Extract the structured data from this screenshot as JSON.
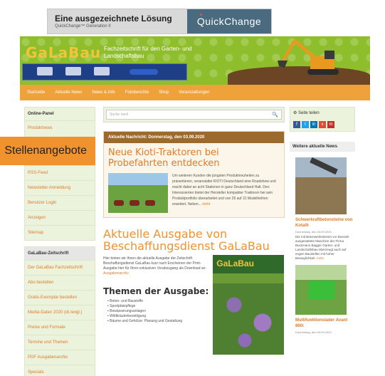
{
  "ad": {
    "title": "Eine ausgezeichnete Lösung",
    "subtitle": "QuickChange™ Generation II",
    "brand": "QuickChange"
  },
  "header": {
    "logo": "GaLaBau",
    "tagline": "Fachzeitschrift für den Garten- und Landschaftsbau"
  },
  "nav": [
    "Startseite",
    "Aktuelle News",
    "News & Info",
    "Fotoberichte",
    "Shop",
    "Veranstaltungen"
  ],
  "overlay_label": "Stellenangebote",
  "left_sidebar": {
    "panel1_title": "Online-Panel",
    "panel1_items": [
      "Produktnews",
      "RSS-Feed",
      "Newsletter Anmeldung",
      "Benutzer Login",
      "Anzeigen",
      "Sitemap"
    ],
    "panel2_title": "GaLaBau-Zeitschrift",
    "panel2_items": [
      "Der GaLaBau Fachzeitschrift",
      "Abo bestellen",
      "Gratis-Exemplar bestellen",
      "Media-Daten 2020 (dt./engl.)",
      "Preise und Formate",
      "Termine und Themen",
      "PDF Ausgabenarchiv",
      "Specials"
    ]
  },
  "main": {
    "search_placeholder": "Suche nach",
    "news_header": "Aktuelle Nachricht: Donnerstag, den 03.09.2020",
    "news_title": "Neue Kioti-Traktoren bei Probefahrten entdecken",
    "news_text": "Um weiteren Kunden die jüngsten Produktneuheiten zu präsentieren, veranstaltet KIOTI Deutschland eine Roadshow und macht dabei an acht Stationen in ganz Deutschland Halt. Den Interessierten bietet der Hersteller kompakter Traktoren bei sein Produktportfolio überarbeitet und von 26 auf 31 Modellreihen erweitert. Neben...",
    "more": "mehr",
    "issue_title": "Aktuelle Ausgabe von Beschaffungsdienst GaLaBau",
    "issue_text": "Hier bieten wir Ihnen die aktuelle Ausgabe der Zeitschrift Beschaffungsdienst GaLaBau kurz nach Erscheinen der Print-Ausgabe hier für Ihren exklusiven Vorabzugang als Download an:",
    "issue_link": "Ausgabenarchiv",
    "cover_title": "GaLaBau",
    "themes_title": "Themen der Ausgabe:",
    "themes": [
      "Beton- und Baustoffe",
      "Sportplatzpflege",
      "Bewässerungsanlagen",
      "Wildkräuterbeseitigung",
      "Bäume und Gehölze: Planung und Gestaltung"
    ]
  },
  "right_sidebar": {
    "share_label": "Seite teilen",
    "share_icons": [
      "f",
      "t",
      "in",
      "x",
      "m"
    ],
    "heading": "Weitere aktuelle News",
    "item1_title": "Schwerkraftbetonsteine von Kotalit",
    "item1_date": "Donnerstag, den 03.09.2020",
    "item1_text": "Die mit Betonwerksteinen vor Bossnik ausgestattete Maschine der Firma Bussmann Bagger Garten- und Landschaftsbau überzeugt auch auf engen Baustellen mit hoher Beweglichkeit.",
    "item1_more": "mehr",
    "item2_title": "Multifunktionslader Avant 860i",
    "item2_date": "Donnerstag, den 03.09.2020"
  }
}
